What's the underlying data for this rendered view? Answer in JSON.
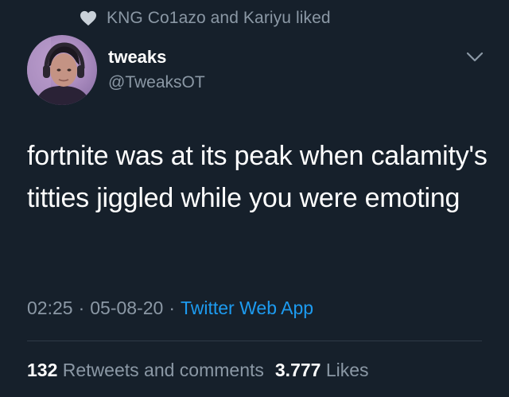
{
  "social_context": {
    "icon": "heart-icon",
    "text": "KNG Co1azo and Kariyu liked"
  },
  "author": {
    "name": "tweaks",
    "handle": "@TweaksOT"
  },
  "tweet": {
    "text": "fortnite was at its peak when calamity's titties jiggled while you were emoting"
  },
  "meta": {
    "time": "02:25",
    "date": "05-08-20",
    "source": "Twitter Web App",
    "separator": "·"
  },
  "stats": {
    "retweets_count": "132",
    "retweets_label": "Retweets and comments",
    "likes_count": "3.777",
    "likes_label": "Likes"
  },
  "colors": {
    "background": "#16202b",
    "secondary_text": "#8b98a5",
    "link": "#1d9bf0"
  }
}
